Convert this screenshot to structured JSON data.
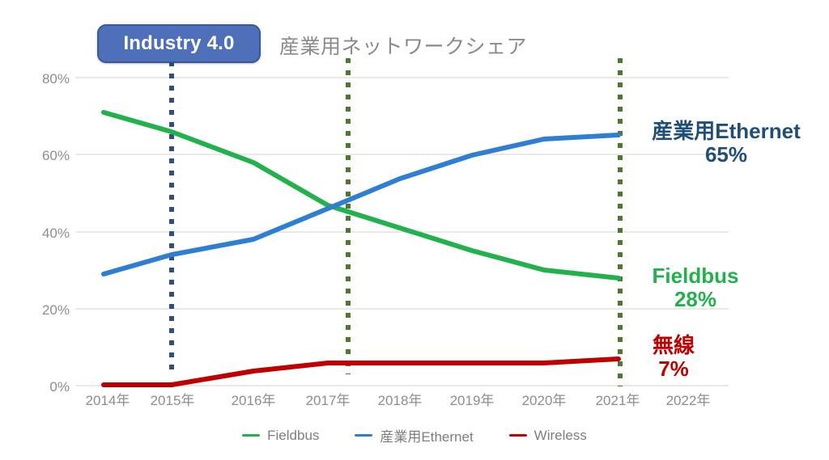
{
  "badge": {
    "label": "Industry 4.0",
    "fill": "#4d70b8",
    "border": "#3a5895",
    "text_color": "#ffffff"
  },
  "callouts": [
    {
      "key": "ethernet",
      "name": "産業用Ethernet",
      "value": "65%",
      "color": "#1f4e79"
    },
    {
      "key": "fieldbus",
      "name": "Fieldbus",
      "value": "28%",
      "color": "#22b14c"
    },
    {
      "key": "wireless",
      "name": "無線",
      "value": "7%",
      "color": "#c00000"
    }
  ],
  "markers": [
    {
      "name": "industry-4-marker",
      "x_label": "2015年",
      "color": "#2d4f83",
      "style": "dotted"
    },
    {
      "name": "mid-marker",
      "x_label": "2017年",
      "color": "#4a7a2c",
      "style": "dotted"
    },
    {
      "name": "end-marker",
      "x_label": "2021年",
      "color": "#4a7a2c",
      "style": "dotted"
    }
  ],
  "legend": {
    "items": [
      {
        "label": "Fieldbus",
        "color": "#22b14c"
      },
      {
        "label": "産業用Ethernet",
        "color": "#2e7ed2"
      },
      {
        "label": "Wireless",
        "color": "#c00000"
      }
    ]
  },
  "chart_data": {
    "type": "line",
    "title": "産業用ネットワークシェア",
    "xlabel": "",
    "ylabel": "",
    "x": [
      "2014年",
      "2015年",
      "2016年",
      "2017年",
      "2018年",
      "2019年",
      "2020年",
      "2021年",
      "2022年"
    ],
    "xtick_labels": [
      "2014年",
      "2015年",
      "2016年",
      "2017年",
      "2018年",
      "2019年",
      "2020年",
      "2021年",
      "2022年"
    ],
    "ytick_labels": [
      "0%",
      "20%",
      "40%",
      "60%",
      "80%"
    ],
    "ytick_values": [
      0,
      20,
      40,
      60,
      80
    ],
    "ylim": [
      0,
      85
    ],
    "grid": "horizontal",
    "legend_position": "bottom-center",
    "series": [
      {
        "name": "Fieldbus",
        "color": "#22b14c",
        "values": [
          71,
          66,
          58,
          47,
          41,
          35,
          30,
          28,
          null
        ]
      },
      {
        "name": "産業用Ethernet",
        "color": "#2e7ed2",
        "values": [
          29,
          34,
          38,
          46,
          54,
          60,
          64,
          65,
          null
        ]
      },
      {
        "name": "Wireless",
        "color": "#c00000",
        "values": [
          0,
          0,
          4,
          6,
          6,
          6,
          6,
          7,
          null
        ]
      }
    ],
    "annotations": [
      {
        "text": "Industry 4.0",
        "at_x": "2015年",
        "type": "badge"
      },
      {
        "text": "産業用Ethernet 65%",
        "at_x": "2021年",
        "type": "callout"
      },
      {
        "text": "Fieldbus 28%",
        "at_x": "2021年",
        "type": "callout"
      },
      {
        "text": "無線 7%",
        "at_x": "2021年",
        "type": "callout"
      }
    ]
  }
}
